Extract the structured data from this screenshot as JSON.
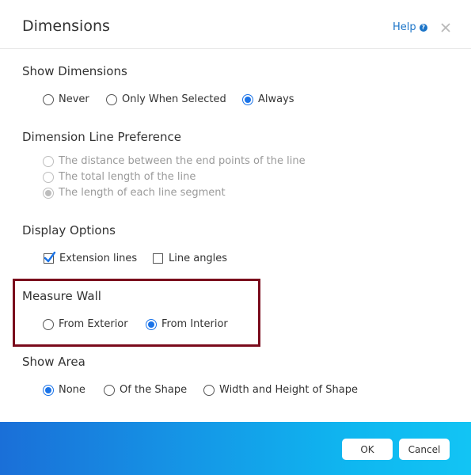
{
  "dialog": {
    "title": "Dimensions",
    "help_label": "Help",
    "help_icon_text": "?",
    "close_icon": "close-icon"
  },
  "sections": {
    "show_dimensions": {
      "title": "Show Dimensions",
      "options": [
        "Never",
        "Only When Selected",
        "Always"
      ],
      "selected": "Always"
    },
    "dimension_line_preference": {
      "title": "Dimension Line Preference",
      "options": [
        "The distance between the end points of the line",
        "The total length of the line",
        "The length of each line segment"
      ],
      "selected": "The length of each line segment",
      "disabled": true
    },
    "display_options": {
      "title": "Display Options",
      "checkboxes": [
        "Extension lines",
        "Line angles"
      ],
      "checked": [
        "Extension lines"
      ]
    },
    "measure_wall": {
      "title": "Measure Wall",
      "options": [
        "From Exterior",
        "From Interior"
      ],
      "selected": "From Interior"
    },
    "show_area": {
      "title": "Show Area",
      "options": [
        "None",
        "Of the Shape",
        "Width and Height of Shape"
      ],
      "selected": "None"
    }
  },
  "footer": {
    "ok_label": "OK",
    "cancel_label": "Cancel"
  },
  "colors": {
    "accent": "#1a73e8",
    "highlight_border": "#7a0b1c",
    "footer_gradient_start": "#1a6fd8",
    "footer_gradient_end": "#12c4f4"
  }
}
